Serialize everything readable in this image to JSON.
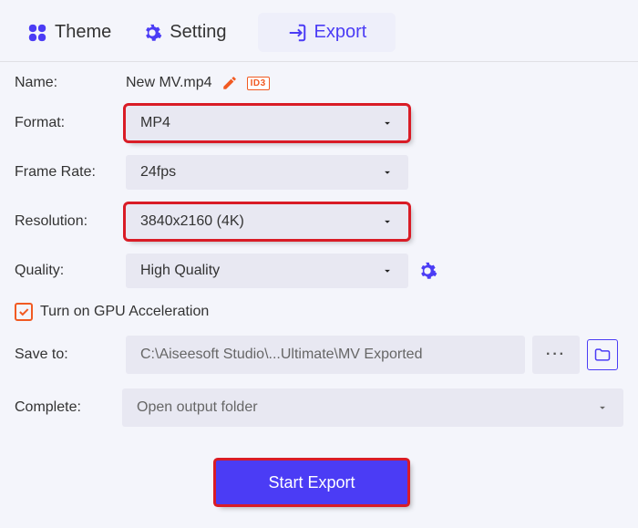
{
  "tabs": {
    "theme": "Theme",
    "setting": "Setting",
    "export": "Export"
  },
  "form": {
    "name_label": "Name:",
    "name_value": "New MV.mp4",
    "id_badge": "ID3",
    "format_label": "Format:",
    "format_value": "MP4",
    "framerate_label": "Frame Rate:",
    "framerate_value": "24fps",
    "resolution_label": "Resolution:",
    "resolution_value": "3840x2160 (4K)",
    "quality_label": "Quality:",
    "quality_value": "High Quality",
    "gpu_label": "Turn on GPU Acceleration",
    "saveto_label": "Save to:",
    "saveto_value": "C:\\Aiseesoft Studio\\...Ultimate\\MV Exported",
    "browse_dots": "···",
    "complete_label": "Complete:",
    "complete_value": "Open output folder",
    "start_button": "Start Export"
  }
}
